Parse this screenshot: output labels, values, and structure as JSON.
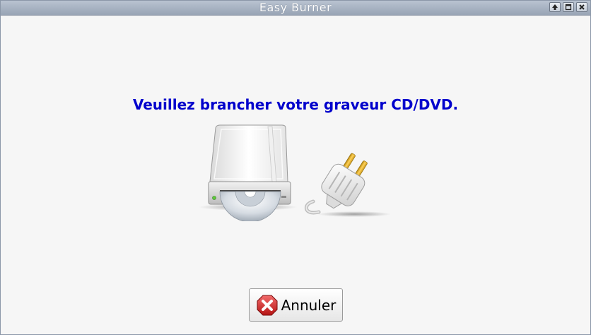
{
  "window": {
    "title": "Easy Burner",
    "controls": [
      "up-arrow-icon",
      "maximize-icon",
      "close-icon"
    ]
  },
  "main": {
    "message": "Veuillez brancher votre graveur CD/DVD.",
    "illustration": [
      "cd-dvd-drive-icon",
      "power-plug-icon"
    ]
  },
  "actions": {
    "cancel_label": "Annuler",
    "cancel_icon": "cancel-x-icon"
  },
  "colors": {
    "message": "#0000cc",
    "titlebar": "#a5b0c0",
    "background": "#f6f6f6",
    "cancel_icon": "#d42a2a"
  }
}
